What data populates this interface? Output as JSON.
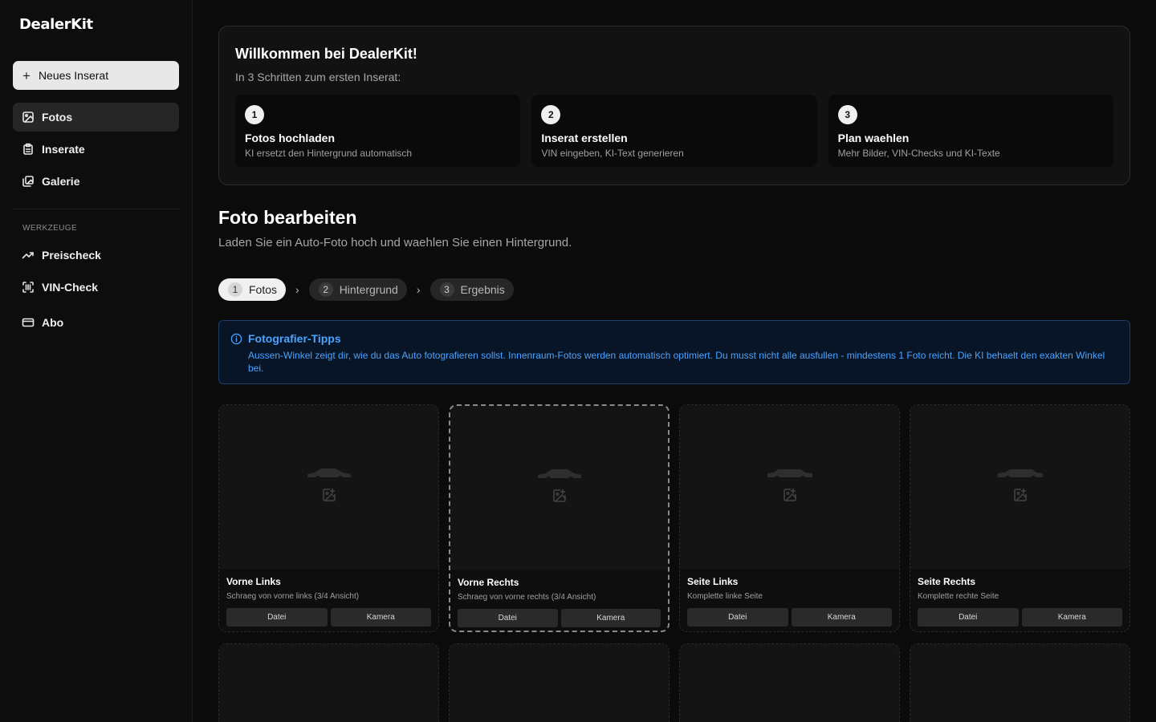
{
  "sidebar": {
    "brand": "DealerKit",
    "new_button": "Neues Inserat",
    "nav": [
      {
        "label": "Fotos",
        "icon": "image-icon",
        "active": true
      },
      {
        "label": "Inserate",
        "icon": "clipboard-icon"
      },
      {
        "label": "Galerie",
        "icon": "images-icon"
      }
    ],
    "tools_label": "WERKZEUGE",
    "tools": [
      {
        "label": "Preischeck",
        "icon": "trending-up-icon"
      },
      {
        "label": "VIN-Check",
        "icon": "scan-barcode-icon"
      },
      {
        "label": "Abo",
        "icon": "credit-card-icon"
      }
    ]
  },
  "welcome": {
    "title": "Willkommen bei DealerKit!",
    "subtitle": "In 3 Schritten zum ersten Inserat:",
    "steps": [
      {
        "num": "1",
        "title": "Fotos hochladen",
        "desc": "KI ersetzt den Hintergrund automatisch"
      },
      {
        "num": "2",
        "title": "Inserat erstellen",
        "desc": "VIN eingeben, KI-Text generieren"
      },
      {
        "num": "3",
        "title": "Plan waehlen",
        "desc": "Mehr Bilder, VIN-Checks und KI-Texte"
      }
    ]
  },
  "main": {
    "title": "Foto bearbeiten",
    "subtitle": "Laden Sie ein Auto-Foto hoch und waehlen Sie einen Hintergrund."
  },
  "stepper": [
    {
      "num": "1",
      "label": "Fotos",
      "active": true
    },
    {
      "num": "2",
      "label": "Hintergrund"
    },
    {
      "num": "3",
      "label": "Ergebnis"
    }
  ],
  "tips": {
    "title": "Fotografier-Tipps",
    "text": "Aussen-Winkel zeigt dir, wie du das Auto fotografieren sollst. Innenraum-Fotos werden automatisch optimiert. Du musst nicht alle ausfullen - mindestens 1 Foto reicht. Die KI behaelt den exakten Winkel bei."
  },
  "slots": [
    {
      "name": "Vorne Links",
      "desc": "Schraeg von vorne links (3/4 Ansicht)",
      "file": "Datei",
      "camera": "Kamera"
    },
    {
      "name": "Vorne Rechts",
      "desc": "Schraeg von vorne rechts (3/4 Ansicht)",
      "file": "Datei",
      "camera": "Kamera",
      "selected": true
    },
    {
      "name": "Seite Links",
      "desc": "Komplette linke Seite",
      "file": "Datei",
      "camera": "Kamera"
    },
    {
      "name": "Seite Rechts",
      "desc": "Komplette rechte Seite",
      "file": "Datei",
      "camera": "Kamera"
    }
  ],
  "colors": {
    "background": "#0b0b0b",
    "accent_blue": "#4aa3ff",
    "tips_border": "#1d3d66"
  }
}
